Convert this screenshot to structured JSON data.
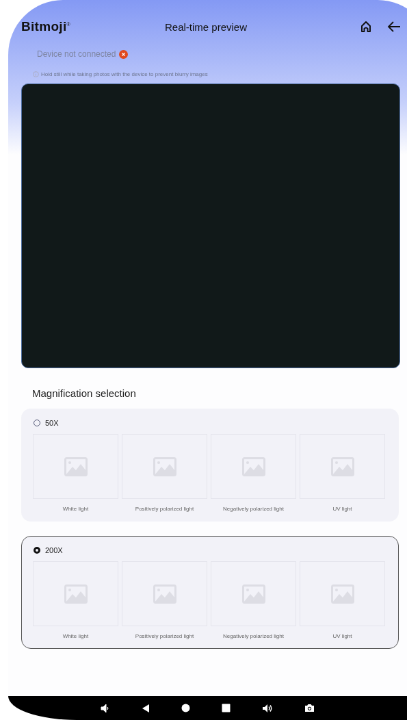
{
  "header": {
    "logo": "Bitmoji$^{®}$",
    "title": "Real-time preview"
  },
  "status": {
    "text": "Device not connected",
    "connected": false
  },
  "hint": "Hold still while taking photos with the device to prevent blurry images",
  "section_title": "Magnification selection",
  "options": [
    {
      "label": "50X",
      "selected": false,
      "images": [
        "White light",
        "Positively polarized light",
        "Negatively polarized light",
        "UV light"
      ]
    },
    {
      "label": "200X",
      "selected": true,
      "images": [
        "White light",
        "Positively polarized light",
        "Negatively polarized light",
        "UV light"
      ]
    }
  ]
}
